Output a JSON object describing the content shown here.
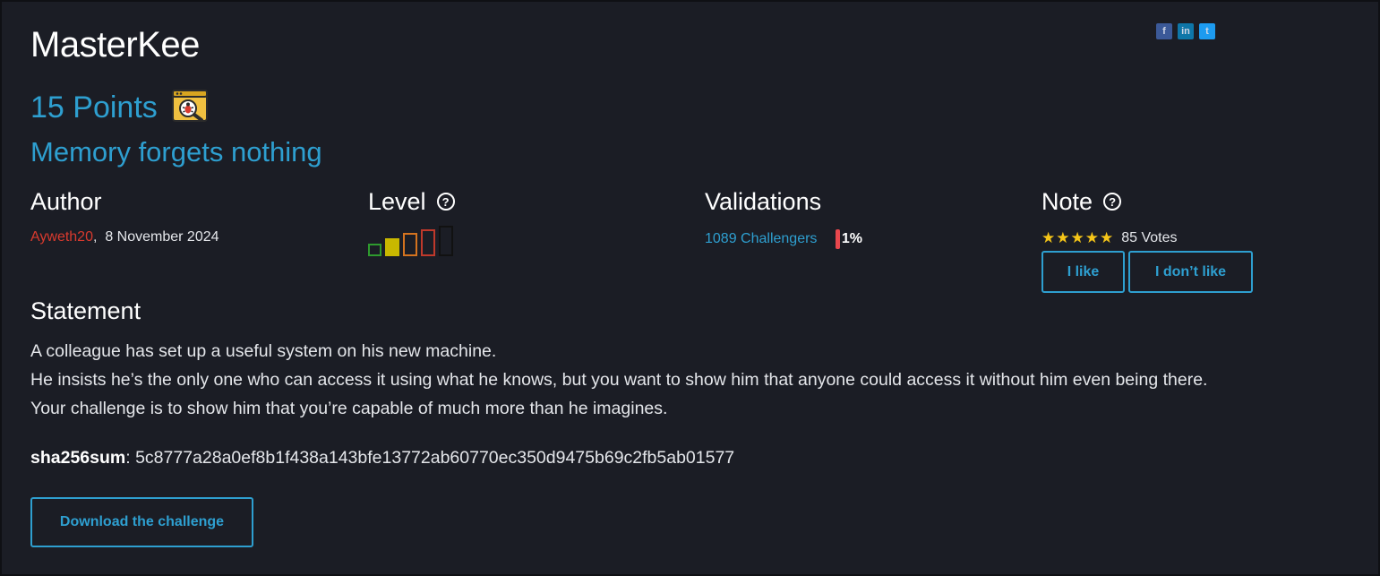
{
  "challenge": {
    "title": "MasterKee",
    "points": "15 Points",
    "category_icon": "bug-magnifier-icon",
    "subtitle": "Memory forgets nothing"
  },
  "social": [
    "facebook-icon",
    "linkedin-icon",
    "twitter-icon"
  ],
  "author": {
    "heading": "Author",
    "name": "Ayweth20",
    "separator": ",",
    "date": "8 November 2024"
  },
  "level": {
    "heading": "Level",
    "help": "?",
    "current": 2,
    "max": 5,
    "colors": [
      "#2e9a2e",
      "#c9b800",
      "#d4731f",
      "#c0392b",
      "#111111"
    ]
  },
  "validations": {
    "heading": "Validations",
    "challengers": "1089 Challengers",
    "percent": "1%"
  },
  "note": {
    "heading": "Note",
    "help": "?",
    "stars": "★★★★★",
    "votes": "85 Votes",
    "like_label": "I like",
    "dislike_label": "I don’t like"
  },
  "statement": {
    "heading": "Statement",
    "lines": [
      "A colleague has set up a useful system on his new machine.",
      "He insists he’s the only one who can access it using what he knows, but you want to show him that anyone could access it without him even being there.",
      "Your challenge is to show him that you’re capable of much more than he imagines."
    ]
  },
  "sha": {
    "label": "sha256sum",
    "value": ": 5c8777a28a0ef8b1f438a143bfe13772ab60770ec350d9475b69c2fb5ab01577"
  },
  "download_label": "Download the challenge",
  "colors": {
    "background": "#1b1d25",
    "accent": "#2e9fd0",
    "author": "#d93a2e",
    "star": "#f5c518",
    "percent_bar": "#e8474d"
  }
}
